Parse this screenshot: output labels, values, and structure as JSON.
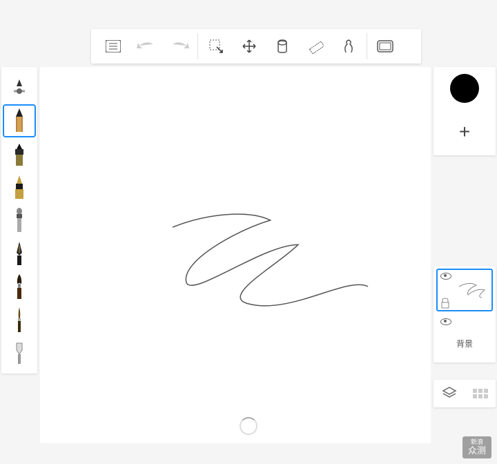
{
  "toolbar": {
    "list": "list",
    "undo": "undo",
    "redo": "redo",
    "select": "select",
    "move": "move",
    "fill": "fill",
    "ruler": "ruler",
    "shape": "shape",
    "frame": "frame"
  },
  "rightpanel": {
    "add_label": "+",
    "background_label": "背景"
  },
  "watermark": {
    "brand": "新浪",
    "product": "众测"
  }
}
